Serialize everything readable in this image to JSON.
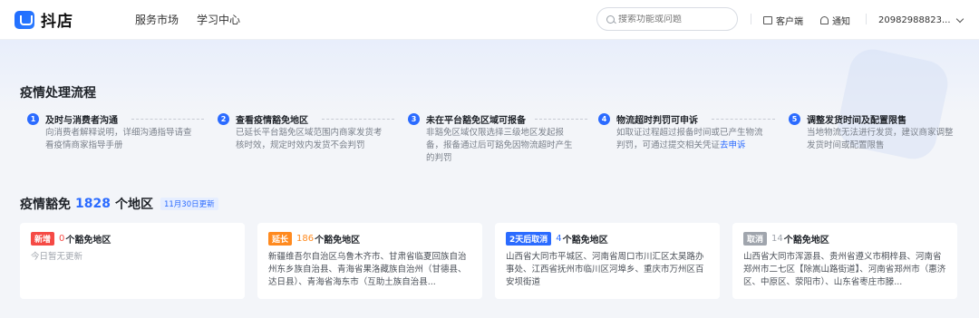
{
  "brand": {
    "name": "抖店"
  },
  "nav": [
    {
      "label": "服务市场"
    },
    {
      "label": "学习中心"
    }
  ],
  "search": {
    "placeholder": "搜索功能或问题"
  },
  "topright": {
    "client": "客户端",
    "notice": "通知",
    "account": "20982988823..."
  },
  "process": {
    "title": "疫情处理流程",
    "steps": [
      {
        "num": "1",
        "title": "及时与消费者沟通",
        "desc": "向消费者解释说明，详细沟通指导请查看疫情商家指导手册",
        "link": ""
      },
      {
        "num": "2",
        "title": "查看疫情豁免地区",
        "desc": "已延长平台豁免区域范围内商家发货考核时效，规定时效内发货不会判罚",
        "link": ""
      },
      {
        "num": "3",
        "title": "未在平台豁免区域可报备",
        "desc": "非豁免区域仅限选择三级地区发起报备，报备通过后可豁免因物流超时产生的判罚",
        "link": ""
      },
      {
        "num": "4",
        "title": "物流超时判罚可申诉",
        "desc": "如取证过程超过报备时间或已产生物流判罚，可通过提交相关凭证",
        "link": "去申诉"
      },
      {
        "num": "5",
        "title": "调整发货时间及配置限售",
        "desc": "当地物流无法进行发货，建议商家调整发货时间或配置限售",
        "link": ""
      }
    ]
  },
  "exemption": {
    "title_prefix": "疫情豁免",
    "count": "1828",
    "title_suffix": "个地区",
    "update_badge": "11月30日更新"
  },
  "cards": [
    {
      "tag": "新增",
      "tag_color": "#f54a45",
      "count": "0",
      "count_color": "#f54a45",
      "label": "个豁免地区",
      "body": "今日暂无更新",
      "muted": true
    },
    {
      "tag": "延长",
      "tag_color": "#ff8a1f",
      "count": "186",
      "count_color": "#ff8a1f",
      "label": "个豁免地区",
      "body": "新疆维吾尔自治区乌鲁木齐市、甘肃省临夏回族自治州东乡族自治县、青海省果洛藏族自治州（甘德县、达日县）、青海省海东市（互助土族自治县...",
      "muted": false
    },
    {
      "tag": "2天后取消",
      "tag_color": "#2b6bff",
      "count": "4",
      "count_color": "#2b6bff",
      "label": "个豁免地区",
      "body": "山西省大同市平城区、河南省周口市川汇区太昊路办事处、江西省抚州市临川区河埠乡、重庆市万州区百安坝街道",
      "muted": false
    },
    {
      "tag": "取消",
      "tag_color": "#a0a5ad",
      "count": "14",
      "count_color": "#a0a5ad",
      "label": "个豁免地区",
      "body": "山西省大同市浑源县、贵州省遵义市桐梓县、河南省郑州市二七区【除嵩山路街道】、河南省郑州市（惠济区、中原区、荥阳市）、山东省枣庄市滕...",
      "muted": false
    }
  ]
}
